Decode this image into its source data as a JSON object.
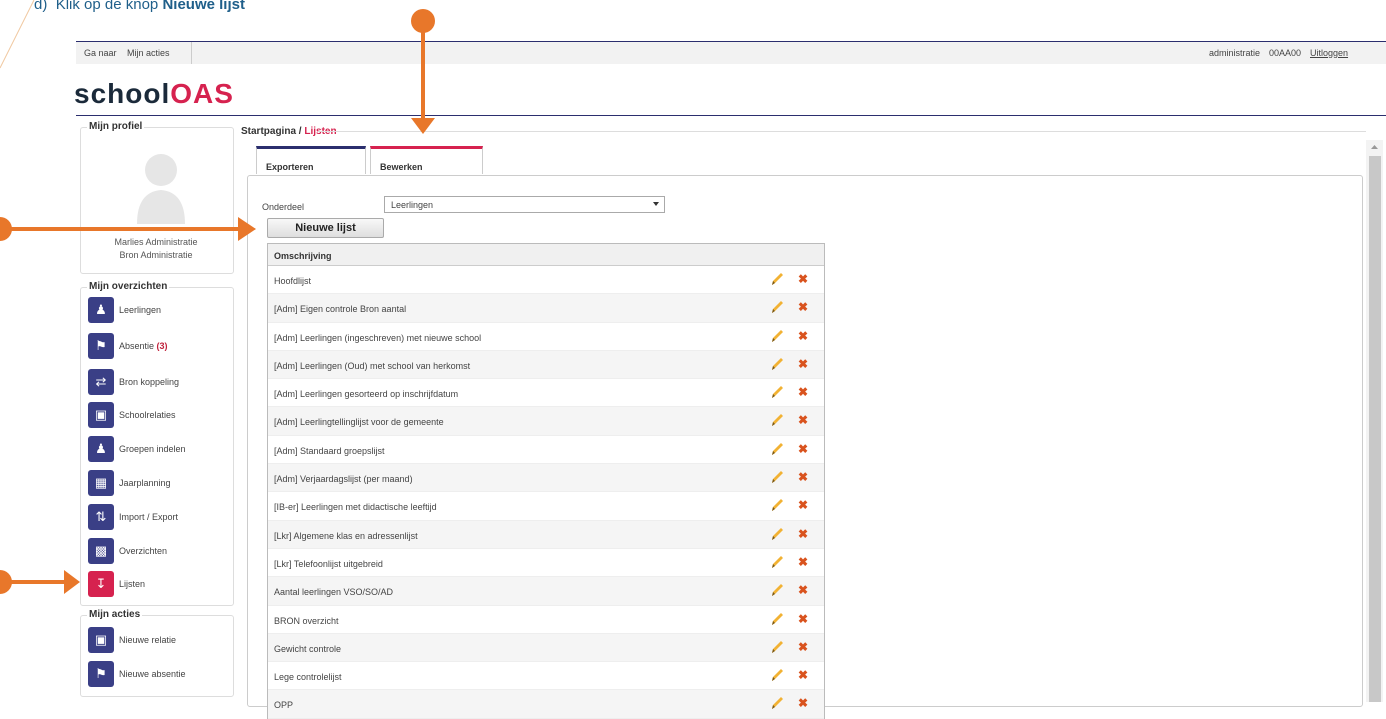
{
  "instruction": {
    "prefix": "d)",
    "text": "Klik op de knop",
    "bold": "Nieuwe lijst"
  },
  "topbar": {
    "goto": "Ga naar",
    "my_actions": "Mijn acties",
    "user": "administratie",
    "code": "00AA00",
    "logout": "Uitloggen"
  },
  "logo": {
    "part1": "school",
    "part2": "OAS"
  },
  "profile": {
    "legend": "Mijn profiel",
    "name1": "Marlies Administratie",
    "name2": "Bron Administratie"
  },
  "overviews": {
    "legend": "Mijn overzichten",
    "items": [
      {
        "label": "Leerlingen",
        "icon": "students-icon"
      },
      {
        "label": "Absentie",
        "count": "(3)",
        "icon": "absence-icon"
      },
      {
        "label": "Bron koppeling",
        "icon": "handshake-icon"
      },
      {
        "label": "Schoolrelaties",
        "icon": "relations-icon"
      },
      {
        "label": "Groepen indelen",
        "icon": "groups-icon"
      },
      {
        "label": "Jaarplanning",
        "icon": "calendar-icon"
      },
      {
        "label": "Import / Export",
        "icon": "import-export-icon"
      },
      {
        "label": "Overzichten",
        "icon": "overview-icon"
      },
      {
        "label": "Lijsten",
        "icon": "lists-icon"
      }
    ]
  },
  "actions": {
    "legend": "Mijn acties",
    "items": [
      {
        "label": "Nieuwe relatie",
        "icon": "new-relation-icon"
      },
      {
        "label": "Nieuwe absentie",
        "icon": "new-absence-icon"
      }
    ]
  },
  "breadcrumb": {
    "home": "Startpagina",
    "sep": " / ",
    "current": "Lijsten"
  },
  "tabs": [
    {
      "label": "Exporteren",
      "color": "#2b2e6e"
    },
    {
      "label": "Bewerken",
      "color": "#d6224f"
    }
  ],
  "form": {
    "label": "Onderdeel",
    "selected": "Leerlingen",
    "new_button": "Nieuwe lijst"
  },
  "table": {
    "header": "Omschrijving",
    "rows": [
      "Hoofdlijst",
      "[Adm] Eigen controle Bron aantal",
      "[Adm] Leerlingen (ingeschreven) met nieuwe school",
      "[Adm] Leerlingen (Oud) met school van herkomst",
      "[Adm] Leerlingen gesorteerd op inschrijfdatum",
      "[Adm] Leerlingtellinglijst voor de gemeente",
      "[Adm] Standaard groepslijst",
      "[Adm] Verjaardagslijst (per maand)",
      "[IB-er] Leerlingen met didactische leeftijd",
      "[Lkr] Algemene klas en adressenlijst",
      "[Lkr] Telefoonlijst uitgebreid",
      "Aantal leerlingen VSO/SO/AD",
      "BRON overzicht",
      "Gewicht controle",
      "Lege controlelijst",
      "OPP"
    ]
  },
  "colors": {
    "brand": "#d6224f",
    "navy": "#2b2e6e",
    "annotation": "#e8772a"
  }
}
